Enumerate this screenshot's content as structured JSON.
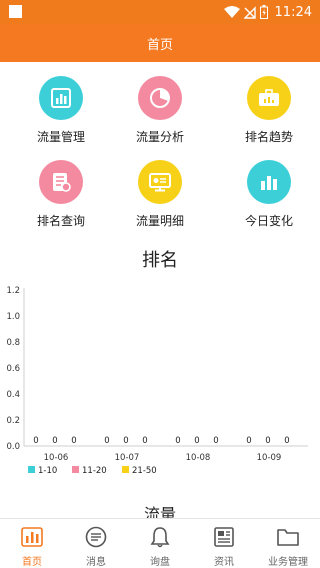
{
  "status_bar": {
    "time": "11:24"
  },
  "header": {
    "title": "首页"
  },
  "menu": [
    {
      "label": "流量管理",
      "icon": "bar-chart-icon",
      "color": "#3ccfd8"
    },
    {
      "label": "流量分析",
      "icon": "pie-chart-icon",
      "color": "#f48aa0"
    },
    {
      "label": "排名趋势",
      "icon": "briefcase-trend-icon",
      "color": "#f7d117"
    },
    {
      "label": "排名查询",
      "icon": "document-query-icon",
      "color": "#f48aa0"
    },
    {
      "label": "流量明细",
      "icon": "monitor-detail-icon",
      "color": "#f7d117"
    },
    {
      "label": "今日变化",
      "icon": "bar-chart-icon",
      "color": "#3ccfd8"
    }
  ],
  "ranking_section": {
    "title": "排名"
  },
  "traffic_section": {
    "title": "流量"
  },
  "chart_data": {
    "type": "bar",
    "categories": [
      "10-06",
      "10-07",
      "10-08",
      "10-09"
    ],
    "series": [
      {
        "name": "1-10",
        "color": "#3ccfd8",
        "values": [
          0,
          0,
          0,
          0
        ]
      },
      {
        "name": "11-20",
        "color": "#f48aa0",
        "values": [
          0,
          0,
          0,
          0
        ]
      },
      {
        "name": "21-50",
        "color": "#f7d117",
        "values": [
          0,
          0,
          0,
          0
        ]
      }
    ],
    "yticks": [
      "0.0",
      "0.2",
      "0.4",
      "0.6",
      "0.8",
      "1.0",
      "1.2"
    ],
    "ylim": [
      0,
      1.2
    ],
    "data_label": "0",
    "legend_position": "bottom-left",
    "grid": false
  },
  "tabs": [
    {
      "label": "首页",
      "icon": "home-chart-icon",
      "active": true
    },
    {
      "label": "消息",
      "icon": "message-icon",
      "active": false
    },
    {
      "label": "询盘",
      "icon": "bell-icon",
      "active": false
    },
    {
      "label": "资讯",
      "icon": "news-icon",
      "active": false
    },
    {
      "label": "业务管理",
      "icon": "folder-icon",
      "active": false
    }
  ],
  "colors": {
    "brand": "#f47920",
    "status_bar": "#f07b1d"
  }
}
